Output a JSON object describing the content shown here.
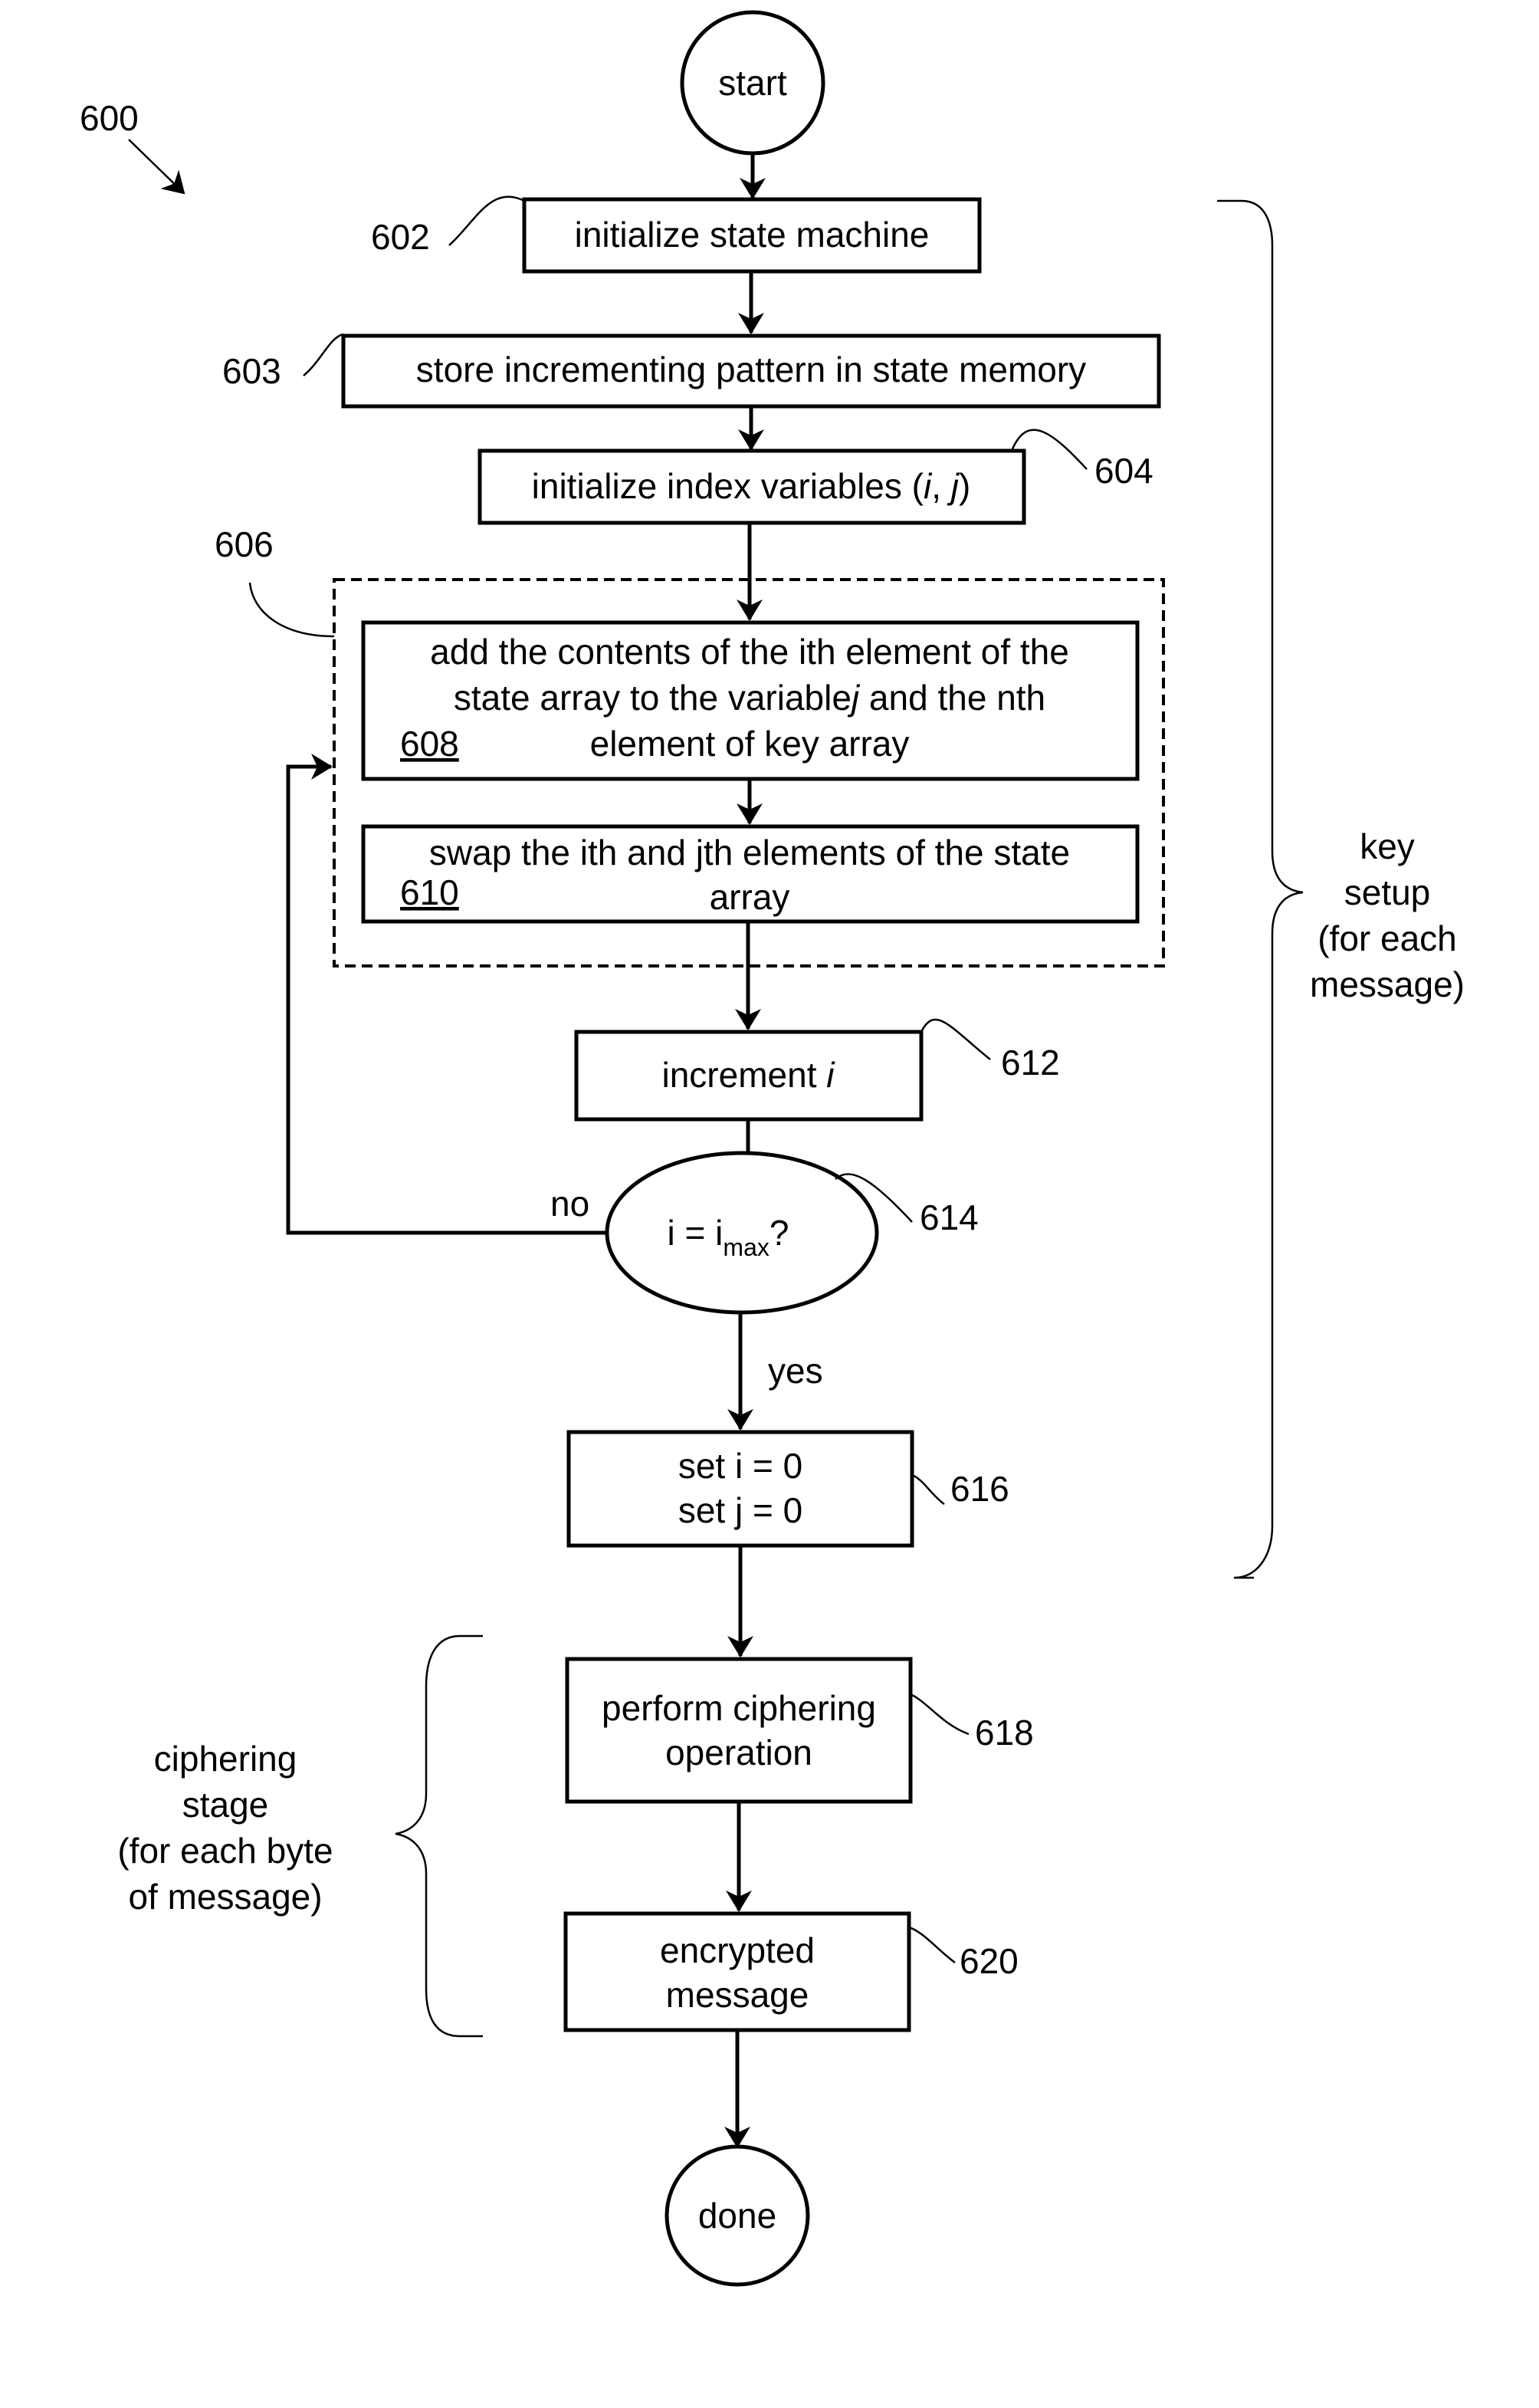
{
  "figure": {
    "number": "600",
    "start": "start",
    "done": "done",
    "steps": {
      "s602": {
        "ref": "602",
        "text": "initialize state machine"
      },
      "s603": {
        "ref": "603",
        "text": "store incrementing pattern in state memory"
      },
      "s604": {
        "ref": "604",
        "text_main": "initialize index variables (",
        "text_i": "i",
        "text_sep": ", ",
        "text_j": "j",
        "text_end": ")"
      },
      "s606": {
        "ref": "606"
      },
      "s608": {
        "ref": "608",
        "line1": "add the contents of the ith element of the",
        "line2_a": "state array to the variable",
        "line2_j": "j",
        "line2_b": " and the nth",
        "line3": "element of key array"
      },
      "s610": {
        "ref": "610",
        "line1": "swap the ith and jth elements of the state",
        "line2": "array"
      },
      "s612": {
        "ref": "612",
        "text": "increment ",
        "text_i": "i"
      },
      "s614": {
        "ref": "614",
        "text_a": "i = i",
        "text_sub": "max",
        "text_b": "?",
        "no": "no",
        "yes": "yes"
      },
      "s616": {
        "ref": "616",
        "line1": "set i = 0",
        "line2": "set j = 0"
      },
      "s618": {
        "ref": "618",
        "line1": "perform ciphering",
        "line2": "operation"
      },
      "s620": {
        "ref": "620",
        "line1": "encrypted",
        "line2": "message"
      }
    },
    "brackets": {
      "key_setup": [
        "key",
        "setup",
        "(for each",
        "message)"
      ],
      "ciphering": [
        "ciphering",
        "stage",
        "(for each byte",
        "of message)"
      ]
    }
  }
}
